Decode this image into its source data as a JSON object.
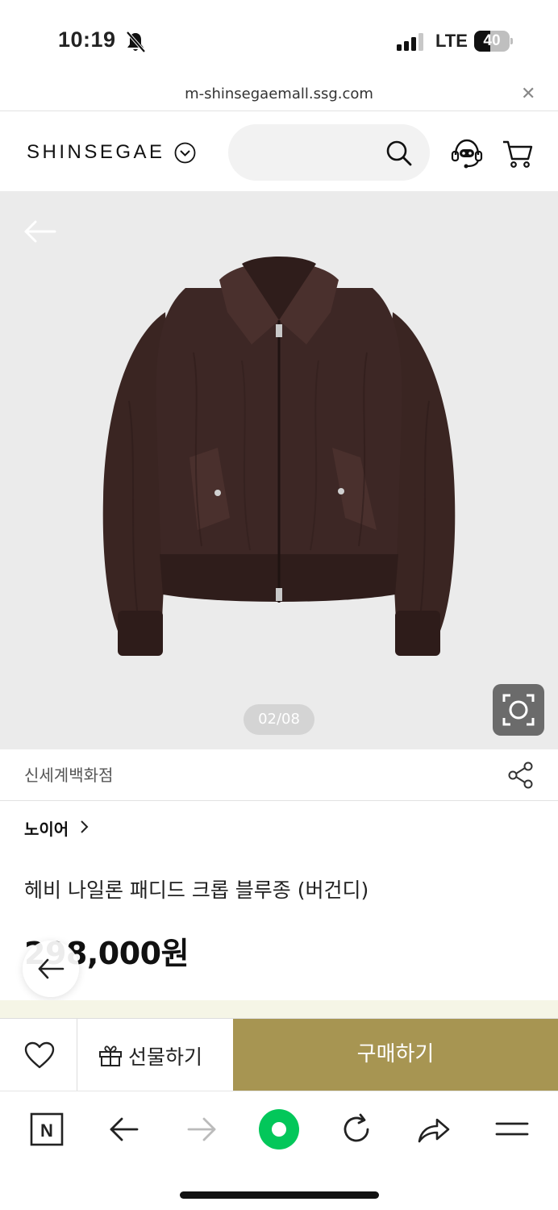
{
  "status": {
    "time": "10:19",
    "network": "LTE",
    "battery": "40"
  },
  "browser": {
    "url": "m-shinsegaemall.ssg.com",
    "close_icon": "close-icon"
  },
  "header": {
    "logo": "SHINSEGAE",
    "search_placeholder": ""
  },
  "gallery": {
    "counter": "02/08"
  },
  "product": {
    "seller": "신세계백화점",
    "brand": "노이어",
    "title": "헤비 나일론 패디드 크롭 블루종 (버건디)",
    "price": "298,000원"
  },
  "actions": {
    "gift_label": "선물하기",
    "buy_label": "구매하기"
  },
  "colors": {
    "buy_button": "#a79552",
    "product_color": "#3a2522"
  }
}
